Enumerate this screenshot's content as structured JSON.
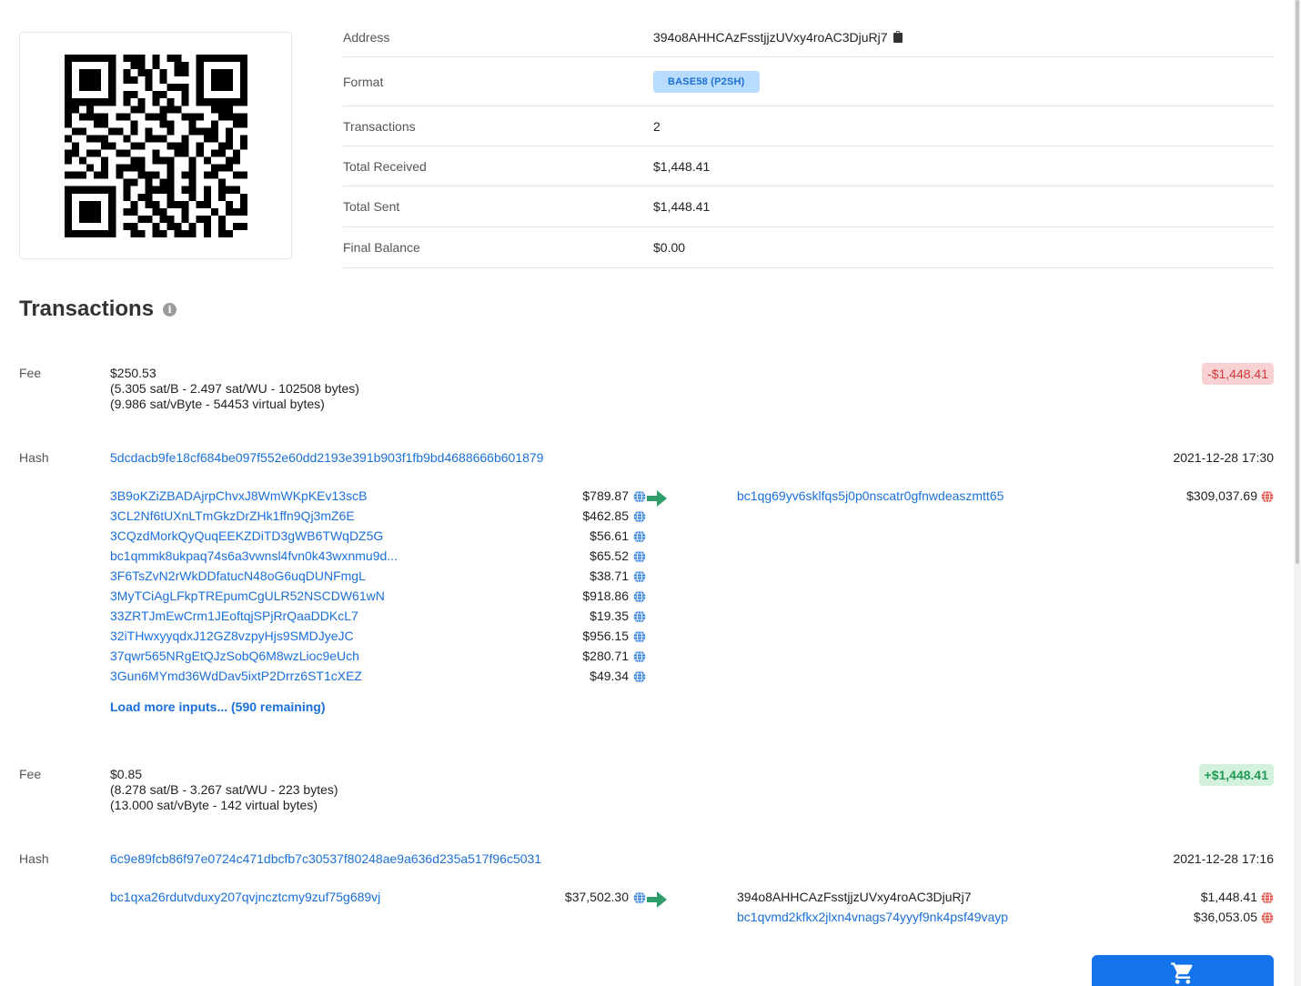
{
  "address_info": {
    "address_label": "Address",
    "address_value": "394o8AHHCAzFsstjjzUVxy4roAC3DjuRj7",
    "format_label": "Format",
    "format_value": "BASE58 (P2SH)",
    "transactions_label": "Transactions",
    "transactions_value": "2",
    "total_received_label": "Total Received",
    "total_received_value": "$1,448.41",
    "total_sent_label": "Total Sent",
    "total_sent_value": "$1,448.41",
    "final_balance_label": "Final Balance",
    "final_balance_value": "$0.00"
  },
  "section_title": "Transactions",
  "tx1": {
    "fee_label": "Fee",
    "fee_amount": "$250.53",
    "fee_line2": "(5.305 sat/B - 2.497 sat/WU - 102508 bytes)",
    "fee_line3": "(9.986 sat/vByte - 54453 virtual bytes)",
    "net_badge": "-$1,448.41",
    "hash_label": "Hash",
    "hash": "5dcdacb9fe18cf684be097f552e60dd2193e391b903f1fb9bd4688666b601879",
    "date": "2021-12-28 17:30",
    "inputs": [
      {
        "address": "3B9oKZiZBADAjrpChvxJ8WmWKpKEv13scB",
        "amount": "$789.87"
      },
      {
        "address": "3CL2Nf6tUXnLTmGkzDrZHk1ffn9Qj3mZ6E",
        "amount": "$462.85"
      },
      {
        "address": "3CQzdMorkQyQuqEEKZDiTD3gWB6TWqDZ5G",
        "amount": "$56.61"
      },
      {
        "address": "bc1qmmk8ukpaq74s6a3vwnsl4fvn0k43wxnmu9d...",
        "amount": "$65.52"
      },
      {
        "address": "3F6TsZvN2rWkDDfatucN48oG6uqDUNFmgL",
        "amount": "$38.71"
      },
      {
        "address": "3MyTCiAgLFkpTREpumCgULR52NSCDW61wN",
        "amount": "$918.86"
      },
      {
        "address": "33ZRTJmEwCrm1JEoftqjSPjRrQaaDDKcL7",
        "amount": "$19.35"
      },
      {
        "address": "32iTHwxyyqdxJ12GZ8vzpyHjs9SMDJyeJC",
        "amount": "$956.15"
      },
      {
        "address": "37qwr565NRgEtQJzSobQ6M8wzLioc9eUch",
        "amount": "$280.71"
      },
      {
        "address": "3Gun6MYmd36WdDav5ixtP2Drrz6ST1cXEZ",
        "amount": "$49.34"
      }
    ],
    "load_more": "Load more inputs... (590 remaining)",
    "outputs": [
      {
        "address": "bc1qg69yv6sklfqs5j0p0nscatr0gfnwdeaszmtt65",
        "amount": "$309,037.69"
      }
    ]
  },
  "tx2": {
    "fee_label": "Fee",
    "fee_amount": "$0.85",
    "fee_line2": "(8.278 sat/B - 3.267 sat/WU - 223 bytes)",
    "fee_line3": "(13.000 sat/vByte - 142 virtual bytes)",
    "net_badge": "+$1,448.41",
    "hash_label": "Hash",
    "hash": "6c9e89fcb86f97e0724c471dbcfb7c30537f80248ae9a636d235a517f96c5031",
    "date": "2021-12-28 17:16",
    "inputs": [
      {
        "address": "bc1qxa26rdutvduxy207qvjncztcmy9zuf75g689vj",
        "amount": "$37,502.30"
      }
    ],
    "outputs": [
      {
        "address": "394o8AHHCAzFsstjjzUVxy4roAC3DjuRj7",
        "amount": "$1,448.41"
      },
      {
        "address": "bc1qvmd2kfkx2jlxn4vnags74yyyf9nk4psf49vayp",
        "amount": "$36,053.05"
      }
    ]
  },
  "colors": {
    "link": "#1a6fd8",
    "negative": "#d43a3a",
    "positive": "#1f9a52",
    "arrow": "#2f9e6a",
    "cart_button": "#1273eb"
  },
  "icons": [
    "qr-code-icon",
    "clipboard-icon",
    "info-icon",
    "globe-icon",
    "arrow-right-icon",
    "cart-icon"
  ]
}
